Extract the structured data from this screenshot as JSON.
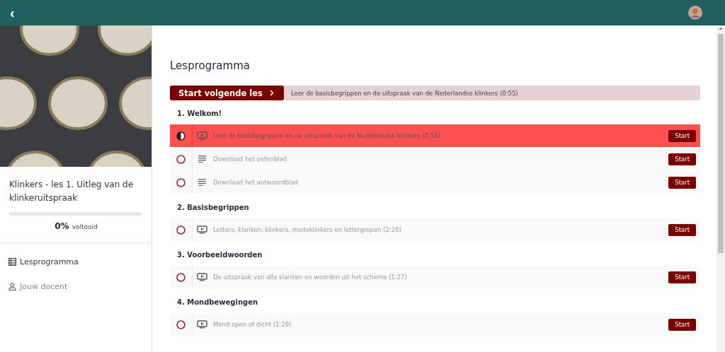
{
  "header": {
    "back": "‹"
  },
  "course": {
    "title": "Klinkers - les 1. Uitleg van de klinkeruitspraak",
    "level": 0,
    "percent": "0%",
    "percent_label": "voltooid"
  },
  "sidebar": {
    "items": [
      {
        "label": "Lesprogramma",
        "kind": "table",
        "selected": true
      },
      {
        "label": "Jouw docent",
        "kind": "person",
        "selected": false
      }
    ]
  },
  "main": {
    "title": "Lesprogramma",
    "next": {
      "button": "Start volgende les",
      "description": "Leer de basisbegrippen en de uitspraak van de Nederlandse klinkers (0:55)"
    },
    "sections": [
      {
        "title": "1. Welkom!",
        "lessons": [
          {
            "kind": "video",
            "title": "Leer de basisbegrippen en de uitspraak van de Nederlandse klinkers (0:55)",
            "started": true,
            "selected": true,
            "button": "Start"
          },
          {
            "kind": "document",
            "title": "Download het oefenblad",
            "started": false,
            "selected": false,
            "button": "Start"
          },
          {
            "kind": "document",
            "title": "Download het antwoordblad",
            "started": false,
            "selected": false,
            "button": "Start"
          }
        ]
      },
      {
        "title": "2. Basisbegrippen",
        "lessons": [
          {
            "kind": "video",
            "title": "Letters, klanken, klinkers, medeklinkers en lettergrepen (2:26)",
            "started": false,
            "selected": false,
            "button": "Start"
          }
        ]
      },
      {
        "title": "3. Voorbeeldwoorden",
        "lessons": [
          {
            "kind": "video",
            "title": "De uitspraak van alle klanken en woorden uit het schema (1:27)",
            "started": false,
            "selected": false,
            "button": "Start"
          }
        ]
      },
      {
        "title": "4. Mondbewegingen",
        "lessons": [
          {
            "kind": "video",
            "title": "Mond open of dicht (1:29)",
            "started": false,
            "selected": false,
            "button": "Start"
          }
        ]
      }
    ]
  }
}
